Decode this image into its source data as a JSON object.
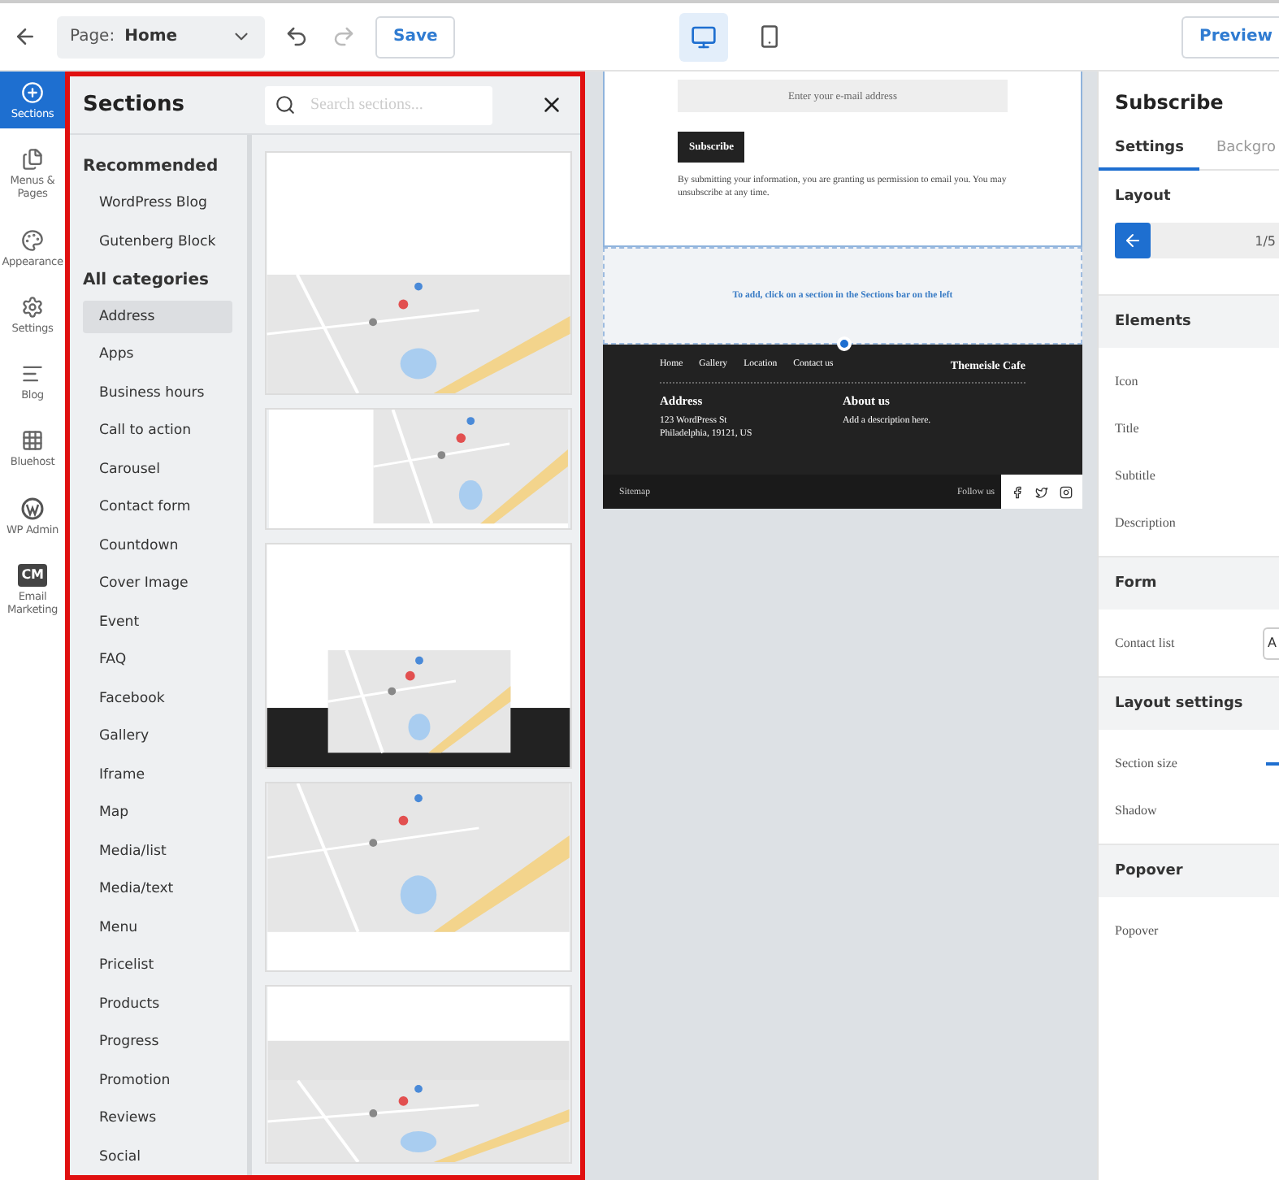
{
  "topbar": {
    "page_select": {
      "label": "Page:",
      "value": "Home"
    },
    "save": "Save",
    "devices": [
      {
        "kind": "desktop",
        "selected": true
      },
      {
        "kind": "mobile",
        "selected": false
      }
    ],
    "preview": "Preview"
  },
  "rail": [
    {
      "kind": "plus",
      "label": "Sections",
      "selected": true
    },
    {
      "kind": "pages",
      "label": "Menus & Pages",
      "selected": false
    },
    {
      "kind": "palette",
      "label": "Appearance",
      "selected": false
    },
    {
      "kind": "gear",
      "label": "Settings",
      "selected": false
    },
    {
      "kind": "blog",
      "label": "Blog",
      "selected": false
    },
    {
      "kind": "grid",
      "label": "Bluehost",
      "selected": false
    },
    {
      "kind": "wp",
      "label": "WP Admin",
      "selected": false
    },
    {
      "kind": "badge",
      "badge": "CM",
      "label": "Email Marketing",
      "selected": false
    }
  ],
  "sections_panel": {
    "title": "Sections",
    "search": {
      "placeholder": "Search sections..."
    },
    "groups": [
      {
        "heading": "Recommended",
        "items": [
          {
            "label": "WordPress Blog",
            "selected": false
          },
          {
            "label": "Gutenberg Block",
            "selected": false
          }
        ]
      },
      {
        "heading": "All categories",
        "items": [
          {
            "label": "Address",
            "selected": true
          },
          {
            "label": "Apps",
            "selected": false
          },
          {
            "label": "Business hours",
            "selected": false
          },
          {
            "label": "Call to action",
            "selected": false
          },
          {
            "label": "Carousel",
            "selected": false
          },
          {
            "label": "Contact form",
            "selected": false
          },
          {
            "label": "Countdown",
            "selected": false
          },
          {
            "label": "Cover Image",
            "selected": false
          },
          {
            "label": "Event",
            "selected": false
          },
          {
            "label": "FAQ",
            "selected": false
          },
          {
            "label": "Facebook",
            "selected": false
          },
          {
            "label": "Gallery",
            "selected": false
          },
          {
            "label": "Iframe",
            "selected": false
          },
          {
            "label": "Map",
            "selected": false
          },
          {
            "label": "Media/list",
            "selected": false
          },
          {
            "label": "Media/text",
            "selected": false
          },
          {
            "label": "Menu",
            "selected": false
          },
          {
            "label": "Pricelist",
            "selected": false
          },
          {
            "label": "Products",
            "selected": false
          },
          {
            "label": "Progress",
            "selected": false
          },
          {
            "label": "Promotion",
            "selected": false
          },
          {
            "label": "Reviews",
            "selected": false
          },
          {
            "label": "Social",
            "selected": false
          }
        ]
      }
    ]
  },
  "canvas": {
    "email_placeholder": "Enter your e-mail address",
    "subscribe_button": "Subscribe",
    "consent": "By submitting your information, you are granting us permission to email you. You may unsubscribe at any time.",
    "add_hint": "To add, click on a section in the Sections bar on the left",
    "footer": {
      "nav": [
        "Home",
        "Gallery",
        "Location",
        "Contact us"
      ],
      "brand": "Themeisle Cafe",
      "columns": [
        {
          "heading": "Address",
          "lines": [
            "123 WordPress St",
            "Philadelphia, 19121, US"
          ]
        },
        {
          "heading": "About us",
          "lines": [
            "Add a description here."
          ]
        }
      ],
      "sitemap": "Sitemap",
      "follow": "Follow us"
    }
  },
  "settings_panel": {
    "title": "Subscribe",
    "tabs": [
      {
        "label": "Settings",
        "selected": true
      },
      {
        "label": "Backgro",
        "selected": false
      }
    ],
    "layout": {
      "heading": "Layout",
      "pager": "1/5"
    },
    "groups": [
      {
        "heading": "Elements",
        "rows": [
          {
            "kind": "text",
            "label": "Icon"
          },
          {
            "kind": "text",
            "label": "Title"
          },
          {
            "kind": "text",
            "label": "Subtitle"
          },
          {
            "kind": "text",
            "label": "Description"
          }
        ]
      },
      {
        "heading": "Form",
        "rows": [
          {
            "kind": "select",
            "label": "Contact list",
            "value": "A"
          }
        ]
      },
      {
        "heading": "Layout settings",
        "rows": [
          {
            "kind": "slider",
            "label": "Section size"
          },
          {
            "kind": "text",
            "label": "Shadow"
          }
        ]
      },
      {
        "heading": "Popover",
        "rows": [
          {
            "kind": "text",
            "label": "Popover"
          }
        ]
      }
    ]
  }
}
